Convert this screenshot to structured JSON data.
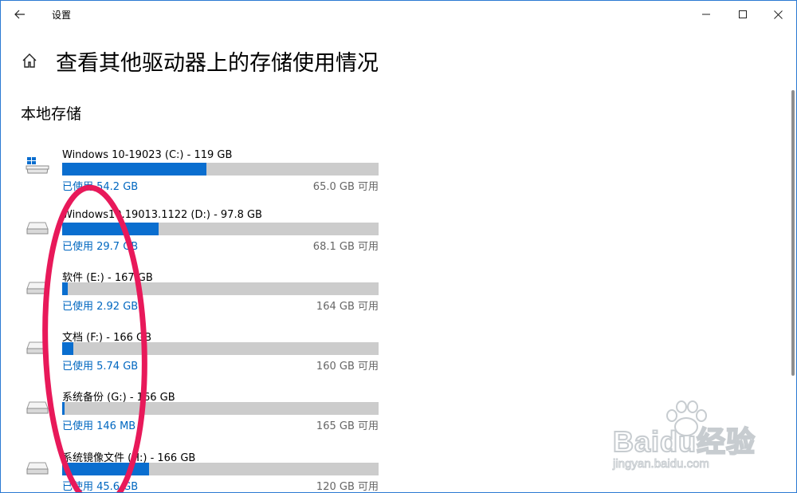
{
  "window": {
    "title": "设置"
  },
  "header": {
    "title": "查看其他驱动器上的存储使用情况"
  },
  "section": {
    "title": "本地存储"
  },
  "drives": [
    {
      "name": "Windows 10-19023 (C:) - 119 GB",
      "used": "已使用 54.2 GB",
      "free": "65.0 GB 可用",
      "used_fraction": 0.455,
      "icon": "windows-system-drive-icon"
    },
    {
      "name": "Windows10.19013.1122 (D:) - 97.8 GB",
      "used": "已使用 29.7 GB",
      "free": "68.1 GB 可用",
      "used_fraction": 0.304,
      "icon": "hard-drive-icon"
    },
    {
      "name": "软件 (E:) - 167 GB",
      "used": "已使用 2.92 GB",
      "free": "164 GB 可用",
      "used_fraction": 0.0175,
      "icon": "hard-drive-icon"
    },
    {
      "name": "文档 (F:) - 166 GB",
      "used": "已使用 5.74 GB",
      "free": "160 GB 可用",
      "used_fraction": 0.0346,
      "icon": "hard-drive-icon"
    },
    {
      "name": "系统备份 (G:) - 166 GB",
      "used": "已使用 146 MB",
      "free": "165 GB 可用",
      "used_fraction": 0.0009,
      "icon": "hard-drive-icon"
    },
    {
      "name": "系统镜像文件 (H:) - 166 GB",
      "used": "已使用 45.6 GB",
      "free": "120 GB 可用",
      "used_fraction": 0.275,
      "icon": "hard-drive-icon"
    }
  ],
  "watermark": {
    "brand": "Baidu经验",
    "url": "jingyan.baidu.com"
  },
  "colors": {
    "accent": "#0a6ecf",
    "bar_track": "#cccccc",
    "link_blue": "#0067c0",
    "annotation": "#e8195a",
    "border": "#2b79d3"
  }
}
